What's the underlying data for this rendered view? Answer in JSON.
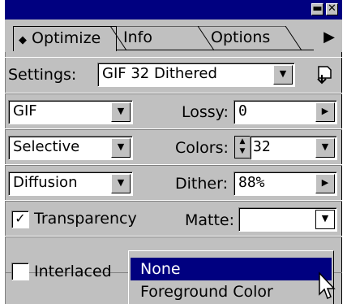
{
  "tabs": {
    "optimize": "Optimize",
    "info": "Info",
    "options": "Options"
  },
  "settings": {
    "label": "Settings:",
    "value": "GIF 32 Dithered"
  },
  "format": {
    "value": "GIF"
  },
  "lossy": {
    "label": "Lossy:",
    "value": "0"
  },
  "palette": {
    "value": "Selective"
  },
  "colors": {
    "label": "Colors:",
    "value": "32"
  },
  "dither_method": {
    "value": "Diffusion"
  },
  "dither": {
    "label": "Dither:",
    "value": "88%"
  },
  "transparency": {
    "label": "Transparency",
    "checked": true
  },
  "matte": {
    "label": "Matte:",
    "value": ""
  },
  "interlaced": {
    "label": "Interlaced",
    "checked": false
  },
  "matte_menu": {
    "items": [
      "None",
      "Foreground Color"
    ],
    "selected": "None"
  },
  "colors_theme": {
    "title_bar": "#000080",
    "panel": "#c0c0c0",
    "highlight": "#000080"
  }
}
